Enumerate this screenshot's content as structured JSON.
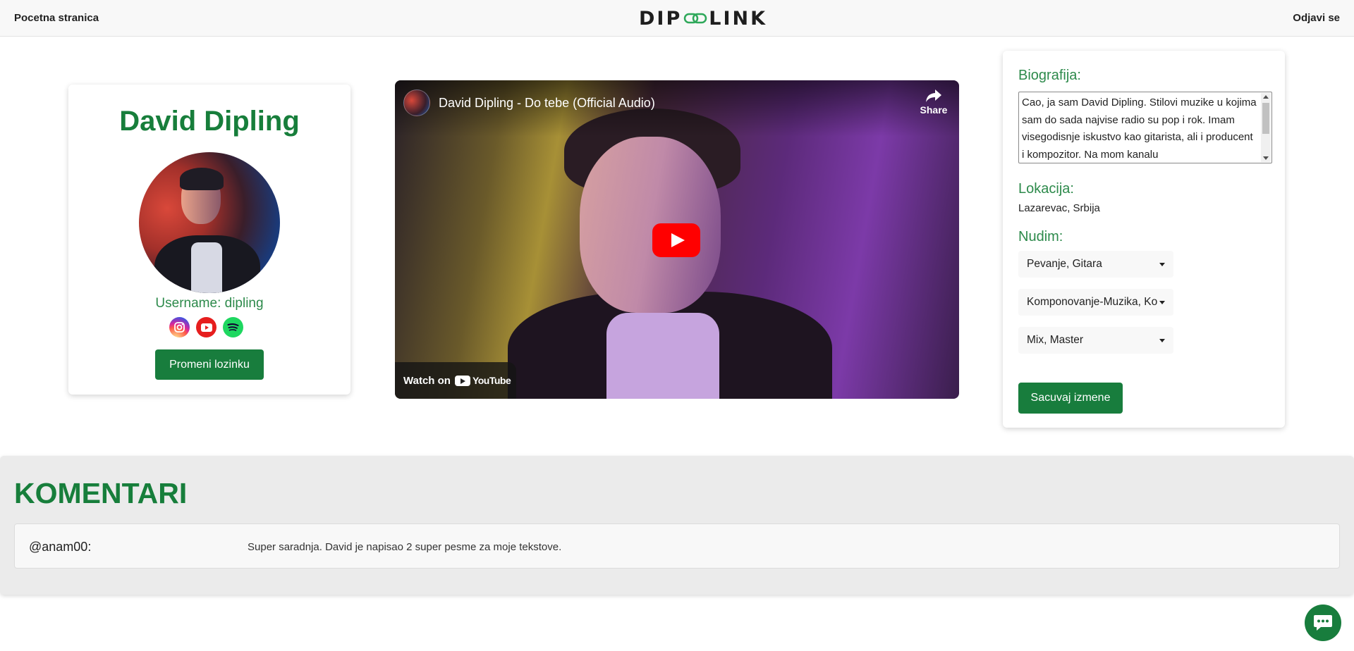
{
  "nav": {
    "home_label": "Pocetna stranica",
    "logo_left": "DIP",
    "logo_right": "LINK",
    "logout_label": "Odjavi se"
  },
  "profile": {
    "name": "David Dipling",
    "username": "Username: dipling",
    "socials": [
      "instagram-icon",
      "youtube-icon",
      "spotify-icon"
    ],
    "change_password_label": "Promeni lozinku"
  },
  "video": {
    "title": "David Dipling - Do tebe (Official Audio)",
    "share_label": "Share",
    "watch_on_label": "Watch on",
    "youtube_label": "YouTube"
  },
  "info": {
    "bio_label": "Biografija:",
    "bio_text": "Cao, ja sam David Dipling. Stilovi muzike u kojima sam do sada najvise radio su pop i rok. Imam visegodisnje iskustvo kao gitarista, ali i producent i kompozitor. Na mom kanalu",
    "location_label": "Lokacija:",
    "location_value": "Lazarevac, Srbija",
    "offer_label": "Nudim:",
    "offers": [
      "Pevanje, Gitara",
      "Komponovanje-Muzika, Ko",
      "Mix, Master"
    ],
    "save_label": "Sacuvaj izmene"
  },
  "comments": {
    "title": "KOMENTARI",
    "items": [
      {
        "user": "@anam00:",
        "text": "Super saradnja. David je napisao 2 super pesme za moje tekstove."
      }
    ]
  },
  "colors": {
    "brand_green": "#187d3d",
    "heading_green": "#177e3b"
  }
}
